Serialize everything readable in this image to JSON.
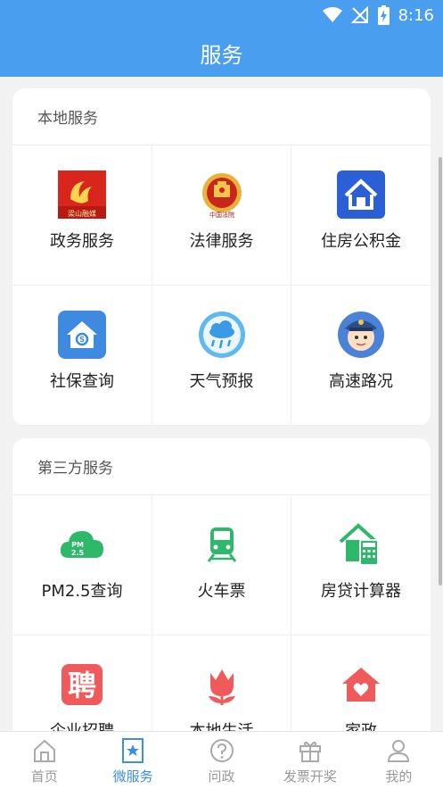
{
  "status": {
    "time": "8:16"
  },
  "header": {
    "title": "服务"
  },
  "local": {
    "title": "本地服务",
    "items": [
      {
        "label": "政务服务",
        "icon": "gov-service-icon",
        "logo_text": "梁山融媒"
      },
      {
        "label": "法律服务",
        "icon": "court-emblem-icon",
        "logo_text": "中国法院"
      },
      {
        "label": "住房公积金",
        "icon": "housing-fund-icon"
      },
      {
        "label": "社保查询",
        "icon": "social-security-icon"
      },
      {
        "label": "天气预报",
        "icon": "weather-rain-icon"
      },
      {
        "label": "高速路况",
        "icon": "traffic-police-icon"
      }
    ]
  },
  "third": {
    "title": "第三方服务",
    "items": [
      {
        "label": "PM2.5查询",
        "icon": "pm25-cloud-icon",
        "icon_text": "PM 2.5"
      },
      {
        "label": "火车票",
        "icon": "train-icon"
      },
      {
        "label": "房贷计算器",
        "icon": "mortgage-calculator-icon"
      },
      {
        "label": "企业招聘",
        "icon": "recruitment-icon",
        "icon_text": "聘"
      },
      {
        "label": "本地生活",
        "icon": "tulip-icon"
      },
      {
        "label": "家政",
        "icon": "home-heart-icon"
      }
    ]
  },
  "tabs": [
    {
      "label": "首页",
      "icon": "home-icon",
      "active": false
    },
    {
      "label": "微服务",
      "icon": "star-bookmark-icon",
      "active": true
    },
    {
      "label": "问政",
      "icon": "question-icon",
      "active": false
    },
    {
      "label": "发票开奖",
      "icon": "gift-box-icon",
      "active": false
    },
    {
      "label": "我的",
      "icon": "person-icon",
      "active": false
    }
  ],
  "colors": {
    "primary": "#4a9ef0",
    "third_party_green": "#2db86a",
    "red": "#f05a5a",
    "active_tab": "#3a8ee6"
  }
}
